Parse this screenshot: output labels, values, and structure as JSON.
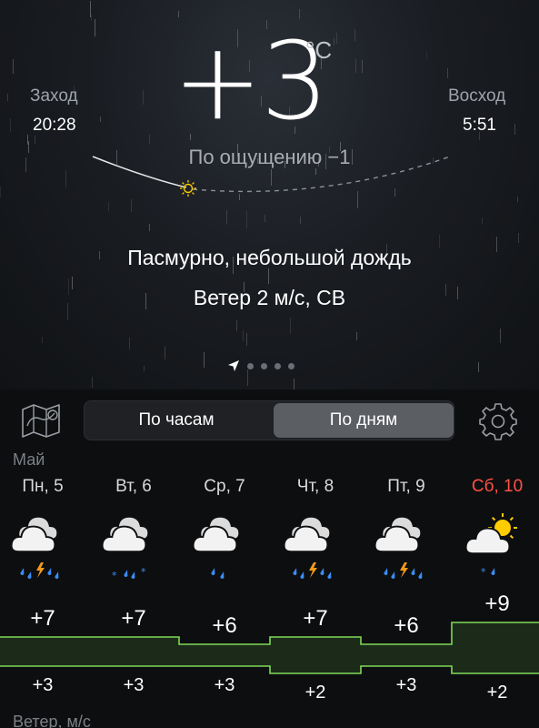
{
  "current": {
    "temperature": "+3",
    "unit": "°C",
    "feels_like": "По ощущению −1",
    "condition": "Пасмурно, небольшой дождь",
    "wind": "Ветер 2 м/с, СВ"
  },
  "sunset": {
    "label": "Заход",
    "time": "20:28"
  },
  "sunrise": {
    "label": "Восход",
    "time": "5:51"
  },
  "pager": {
    "pages": 5,
    "active": 0
  },
  "toolbar": {
    "map_icon": "map-icon",
    "settings_icon": "gear-icon",
    "tabs": [
      {
        "label": "По часам",
        "selected": false
      },
      {
        "label": "По дням",
        "selected": true
      }
    ]
  },
  "forecast": {
    "month": "Май",
    "days": [
      {
        "label": "Пн, 5",
        "high": "+7",
        "low": "+3",
        "icon": "cloud-thunder-rain-icon",
        "weekend": false
      },
      {
        "label": "Вт, 6",
        "high": "+7",
        "low": "+3",
        "icon": "cloud-snow-rain-icon",
        "weekend": false
      },
      {
        "label": "Ср, 7",
        "high": "+6",
        "low": "+3",
        "icon": "cloud-rain-icon",
        "weekend": false
      },
      {
        "label": "Чт, 8",
        "high": "+7",
        "low": "+2",
        "icon": "cloud-thunder-rain-icon",
        "weekend": false
      },
      {
        "label": "Пт, 9",
        "high": "+6",
        "low": "+3",
        "icon": "cloud-thunder-rain-icon",
        "weekend": false
      },
      {
        "label": "Сб, 10",
        "high": "+9",
        "low": "+2",
        "icon": "sun-cloud-snow-icon",
        "weekend": true
      }
    ],
    "wind_label": "Ветер, м/с"
  },
  "colors": {
    "accent_green": "#7ed957",
    "weekend_red": "#ff5147",
    "rain_blue": "#3a8df5",
    "bolt_orange": "#f29a1a",
    "sun_yellow": "#ffcc00"
  }
}
